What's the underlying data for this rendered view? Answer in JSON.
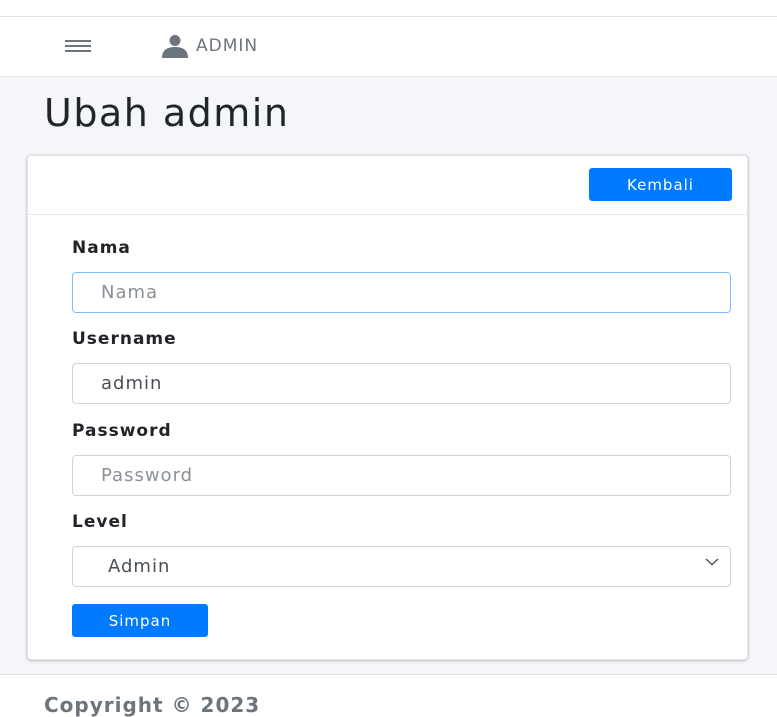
{
  "navbar": {
    "user_label": "ADMIN"
  },
  "page": {
    "title": "Ubah admin"
  },
  "card": {
    "back_button": "Kembali"
  },
  "form": {
    "nama": {
      "label": "Nama",
      "value": "",
      "placeholder": "Nama"
    },
    "username": {
      "label": "Username",
      "value": "admin",
      "placeholder": ""
    },
    "password": {
      "label": "Password",
      "value": "",
      "placeholder": "Password"
    },
    "level": {
      "label": "Level",
      "selected": "Admin"
    },
    "submit_label": "Simpan"
  },
  "footer": {
    "copyright": "Copyright © 2023"
  },
  "colors": {
    "primary": "#007bff",
    "content_bg": "#f4f6f9",
    "focus_border": "#80bdff"
  },
  "icons": {
    "menu": "hamburger-icon",
    "user": "user-icon",
    "select": "chevron-down-icon"
  }
}
